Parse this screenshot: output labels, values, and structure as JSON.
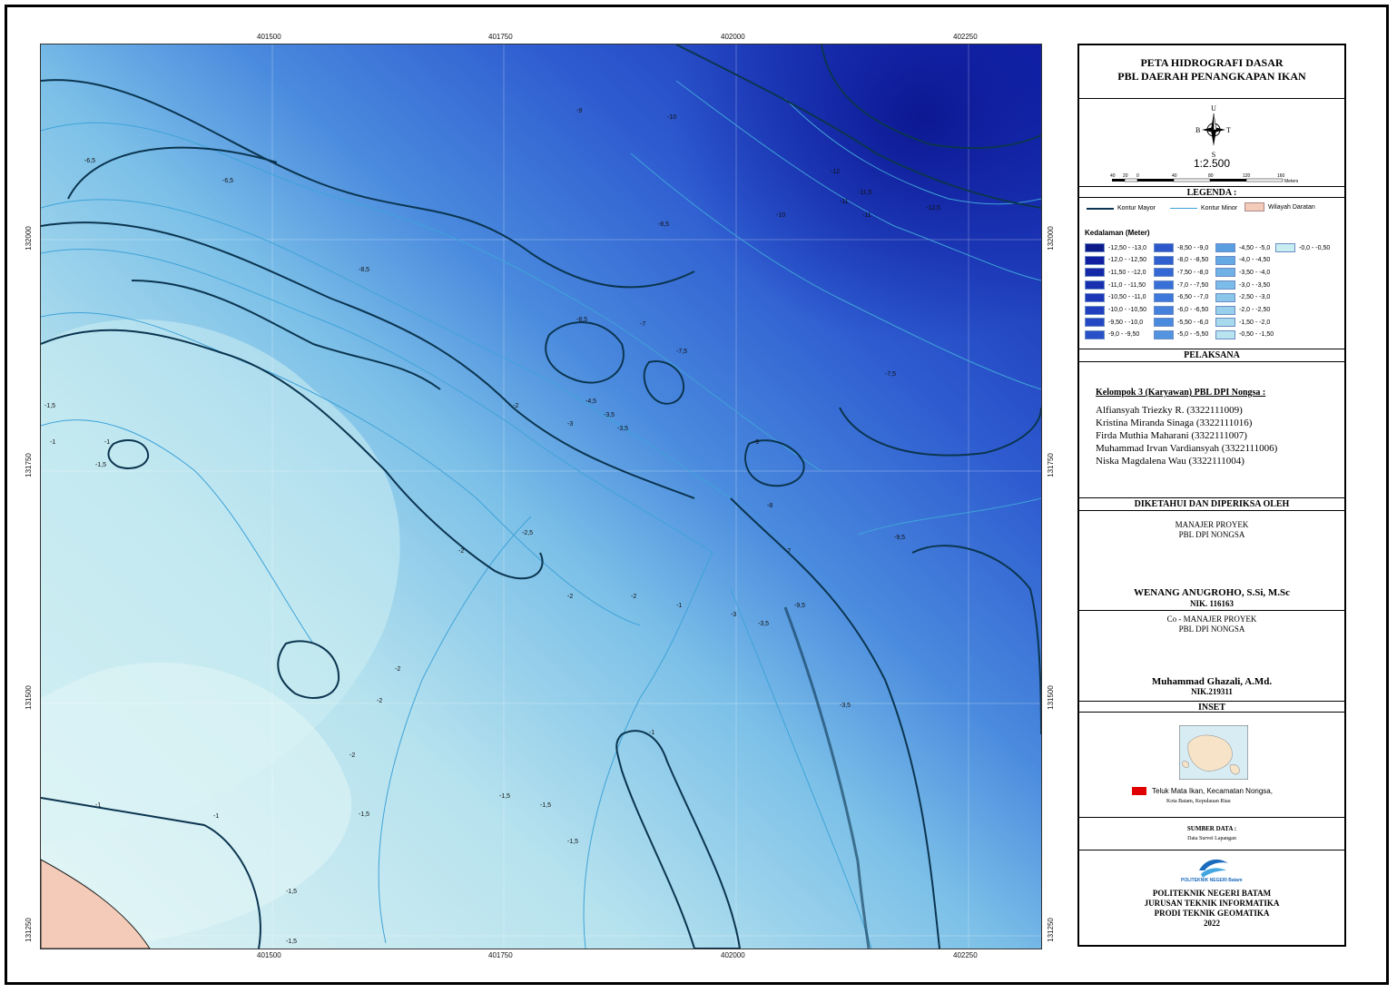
{
  "coords": {
    "x_labels": [
      "401500",
      "401750",
      "402000",
      "402250"
    ],
    "y_labels": [
      "132000",
      "131750",
      "131500",
      "131250"
    ]
  },
  "map": {
    "contour_labels": [
      "-6,5",
      "-8,5",
      "-9",
      "-10",
      "-11",
      "-11,5",
      "-12",
      "-12,5",
      "-7,5",
      "-8",
      "-7",
      "-6",
      "-5,5",
      "-5",
      "-4,5",
      "-4",
      "-3,5",
      "-3",
      "-2,5",
      "-2",
      "-1,5",
      "-1",
      "-9,5"
    ]
  },
  "panel": {
    "title_line1": "PETA HIDROGRAFI DASAR",
    "title_line2": "PBL DAERAH PENANGKAPAN IKAN",
    "compass": {
      "n": "U",
      "s": "S",
      "e": "T",
      "w": "B"
    },
    "scale": "1:2.500",
    "scalebar_labels": [
      "40",
      "20",
      "0",
      "40",
      "80",
      "120",
      "160"
    ],
    "scalebar_unit": "Meters",
    "legend_title": "LEGENDA :",
    "legend_lines": {
      "major": "Kontur Mayor",
      "minor": "Kontur Minor",
      "land": "Wilayah Daratan"
    },
    "depth_title": "Kedalaman (Meter)",
    "depth_classes": [
      {
        "label": "-12,50 - -13,0",
        "color": "#0d1a8a"
      },
      {
        "label": "-12,0 - -12,50",
        "color": "#1020a0"
      },
      {
        "label": "-11,50 - -12,0",
        "color": "#1428a8"
      },
      {
        "label": "-11,0 - -11,50",
        "color": "#1830b0"
      },
      {
        "label": "-10,50 - -11,0",
        "color": "#1c38b8"
      },
      {
        "label": "-10,0 - -10,50",
        "color": "#2040bf"
      },
      {
        "label": "-9,50 - -10,0",
        "color": "#2448c4"
      },
      {
        "label": "-9,0 - -9,50",
        "color": "#2850c8"
      },
      {
        "label": "-8,50 - -9,0",
        "color": "#2c58cc"
      },
      {
        "label": "-8,0 - -8,50",
        "color": "#3060d0"
      },
      {
        "label": "-7,50 - -8,0",
        "color": "#3468d4"
      },
      {
        "label": "-7,0 - -7,50",
        "color": "#3870d8"
      },
      {
        "label": "-6,50 - -7,0",
        "color": "#3e78da"
      },
      {
        "label": "-6,0 - -6,50",
        "color": "#4480dc"
      },
      {
        "label": "-5,50 - -6,0",
        "color": "#4a8ade"
      },
      {
        "label": "-5,0 - -5,50",
        "color": "#5294e0"
      },
      {
        "label": "-4,50 - -5,0",
        "color": "#5a9ee2"
      },
      {
        "label": "-4,0 - -4,50",
        "color": "#64a8e4"
      },
      {
        "label": "-3,50 - -4,0",
        "color": "#70b2e6"
      },
      {
        "label": "-3,0 - -3,50",
        "color": "#7cbce8"
      },
      {
        "label": "-2,50 - -3,0",
        "color": "#8ac6ea"
      },
      {
        "label": "-2,0 - -2,50",
        "color": "#98d0ec"
      },
      {
        "label": "-1,50 - -2,0",
        "color": "#a8daee"
      },
      {
        "label": "-0,50 - -1,50",
        "color": "#b8e4f0"
      },
      {
        "label": "-0,0 - -0,50",
        "color": "#c8eef2"
      }
    ],
    "pelaksana_title": "PELAKSANA",
    "group_name": "Kelompok 3 (Karyawan) PBL DPI Nongsa  :",
    "members": [
      "Alfiansyah Triezky R. (3322111009)",
      "Kristina Miranda Sinaga (3322111016)",
      "Firda Muthia Maharani (3322111007)",
      "Muhammad Irvan Vardiansyah (3322111006)",
      "Niska Magdalena Wau (3322111004)"
    ],
    "checked_title": "DIKETAHUI DAN DIPERIKSA OLEH",
    "manager_role_1": "MANAJER PROYEK",
    "manager_role_2": "PBL DPI NONGSA",
    "manager_name": "WENANG ANUGROHO, S.Si, M.Sc",
    "manager_nik": "NIK. 116163",
    "co_role_1": "Co - MANAJER PROYEK",
    "co_role_2": "PBL DPI NONGSA",
    "co_name": "Muhammad Ghazali, A.Md.",
    "co_nik": "NIK.219311",
    "inset_title": "INSET",
    "inset_caption_1": "Teluk Mata Ikan, Kecamatan Nongsa,",
    "inset_caption_2": "Kota Batam, Kepulauan Riau",
    "source_title": "SUMBER DATA :",
    "source_value": "Data Survei Lapangan",
    "logo_text": "POLITEKNIK NEGERI Batam",
    "inst_1": "POLITEKNIK NEGERI BATAM",
    "inst_2": "JURUSAN TEKNIK INFORMATIKA",
    "inst_3": "PRODI TEKNIK GEOMATIKA",
    "year": "2022"
  },
  "colors": {
    "deep": "#1024b0",
    "mid": "#3c7ad8",
    "shallow": "#bfe8ef",
    "land": "#f4cbb8",
    "major_contour": "#0b3550",
    "minor_contour": "#3fa3d8",
    "inset_marker": "#e00000"
  }
}
